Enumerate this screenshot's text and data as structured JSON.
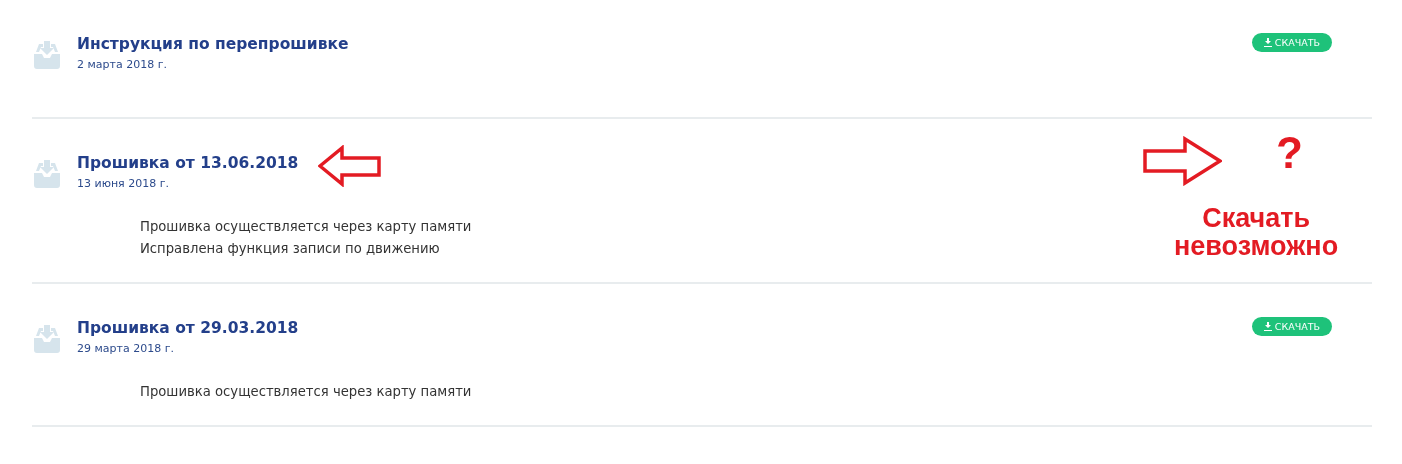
{
  "files": [
    {
      "title": "Инструкция по перепрошивке",
      "date": "2 марта 2018 г.",
      "download_label": "СКАЧАТЬ"
    },
    {
      "title": "Прошивка от 13.06.2018",
      "date": "13 июня 2018 г.",
      "description": [
        "Прошивка осуществляется через карту памяти",
        "Исправлена функция записи по движению"
      ]
    },
    {
      "title": "Прошивка от 29.03.2018",
      "date": "29 марта 2018 г.",
      "download_label": "СКАЧАТЬ",
      "description": [
        "Прошивка осуществляется через карту памяти"
      ]
    }
  ],
  "annotations": [
    {
      "kind": "arrow-left"
    },
    {
      "kind": "arrow-right"
    },
    {
      "kind": "mark",
      "text": "?"
    },
    {
      "kind": "note",
      "text": "Скачать\nневозможно"
    }
  ]
}
